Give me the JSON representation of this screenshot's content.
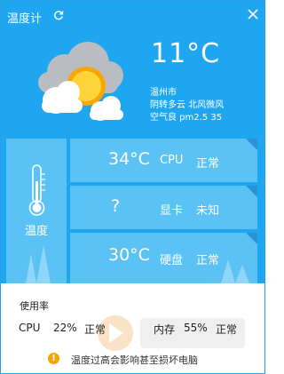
{
  "window": {
    "title": "温度计"
  },
  "weather": {
    "temperature": "11°C",
    "city": "温州市",
    "condition": "阴转多云 北风微风",
    "air_quality": "空气良  pm2.5 35"
  },
  "tiles": {
    "left_label": "温度",
    "cpu": {
      "value": "34°C",
      "name": "CPU",
      "state": "正常"
    },
    "gpu": {
      "value": "?",
      "name": "显卡",
      "state": "未知"
    },
    "disk": {
      "value": "30°C",
      "name": "硬盘",
      "state": "正常"
    }
  },
  "usage": {
    "title": "使用率",
    "cpu_label": "CPU",
    "cpu_percent": "22%",
    "cpu_state": "正常",
    "mem_label": "内存",
    "mem_percent": "55%",
    "mem_state": "正常"
  },
  "warning": {
    "icon": "!",
    "text": "温度过高会影响甚至损坏电脑"
  },
  "icons": [
    "refresh-icon",
    "close-icon",
    "weather-cloudy-sun-icon",
    "thermometer-icon",
    "warning-icon"
  ],
  "colors": {
    "accent": "#1fa6f1",
    "tile": "#5bc2f5",
    "warning": "#f5a400"
  }
}
